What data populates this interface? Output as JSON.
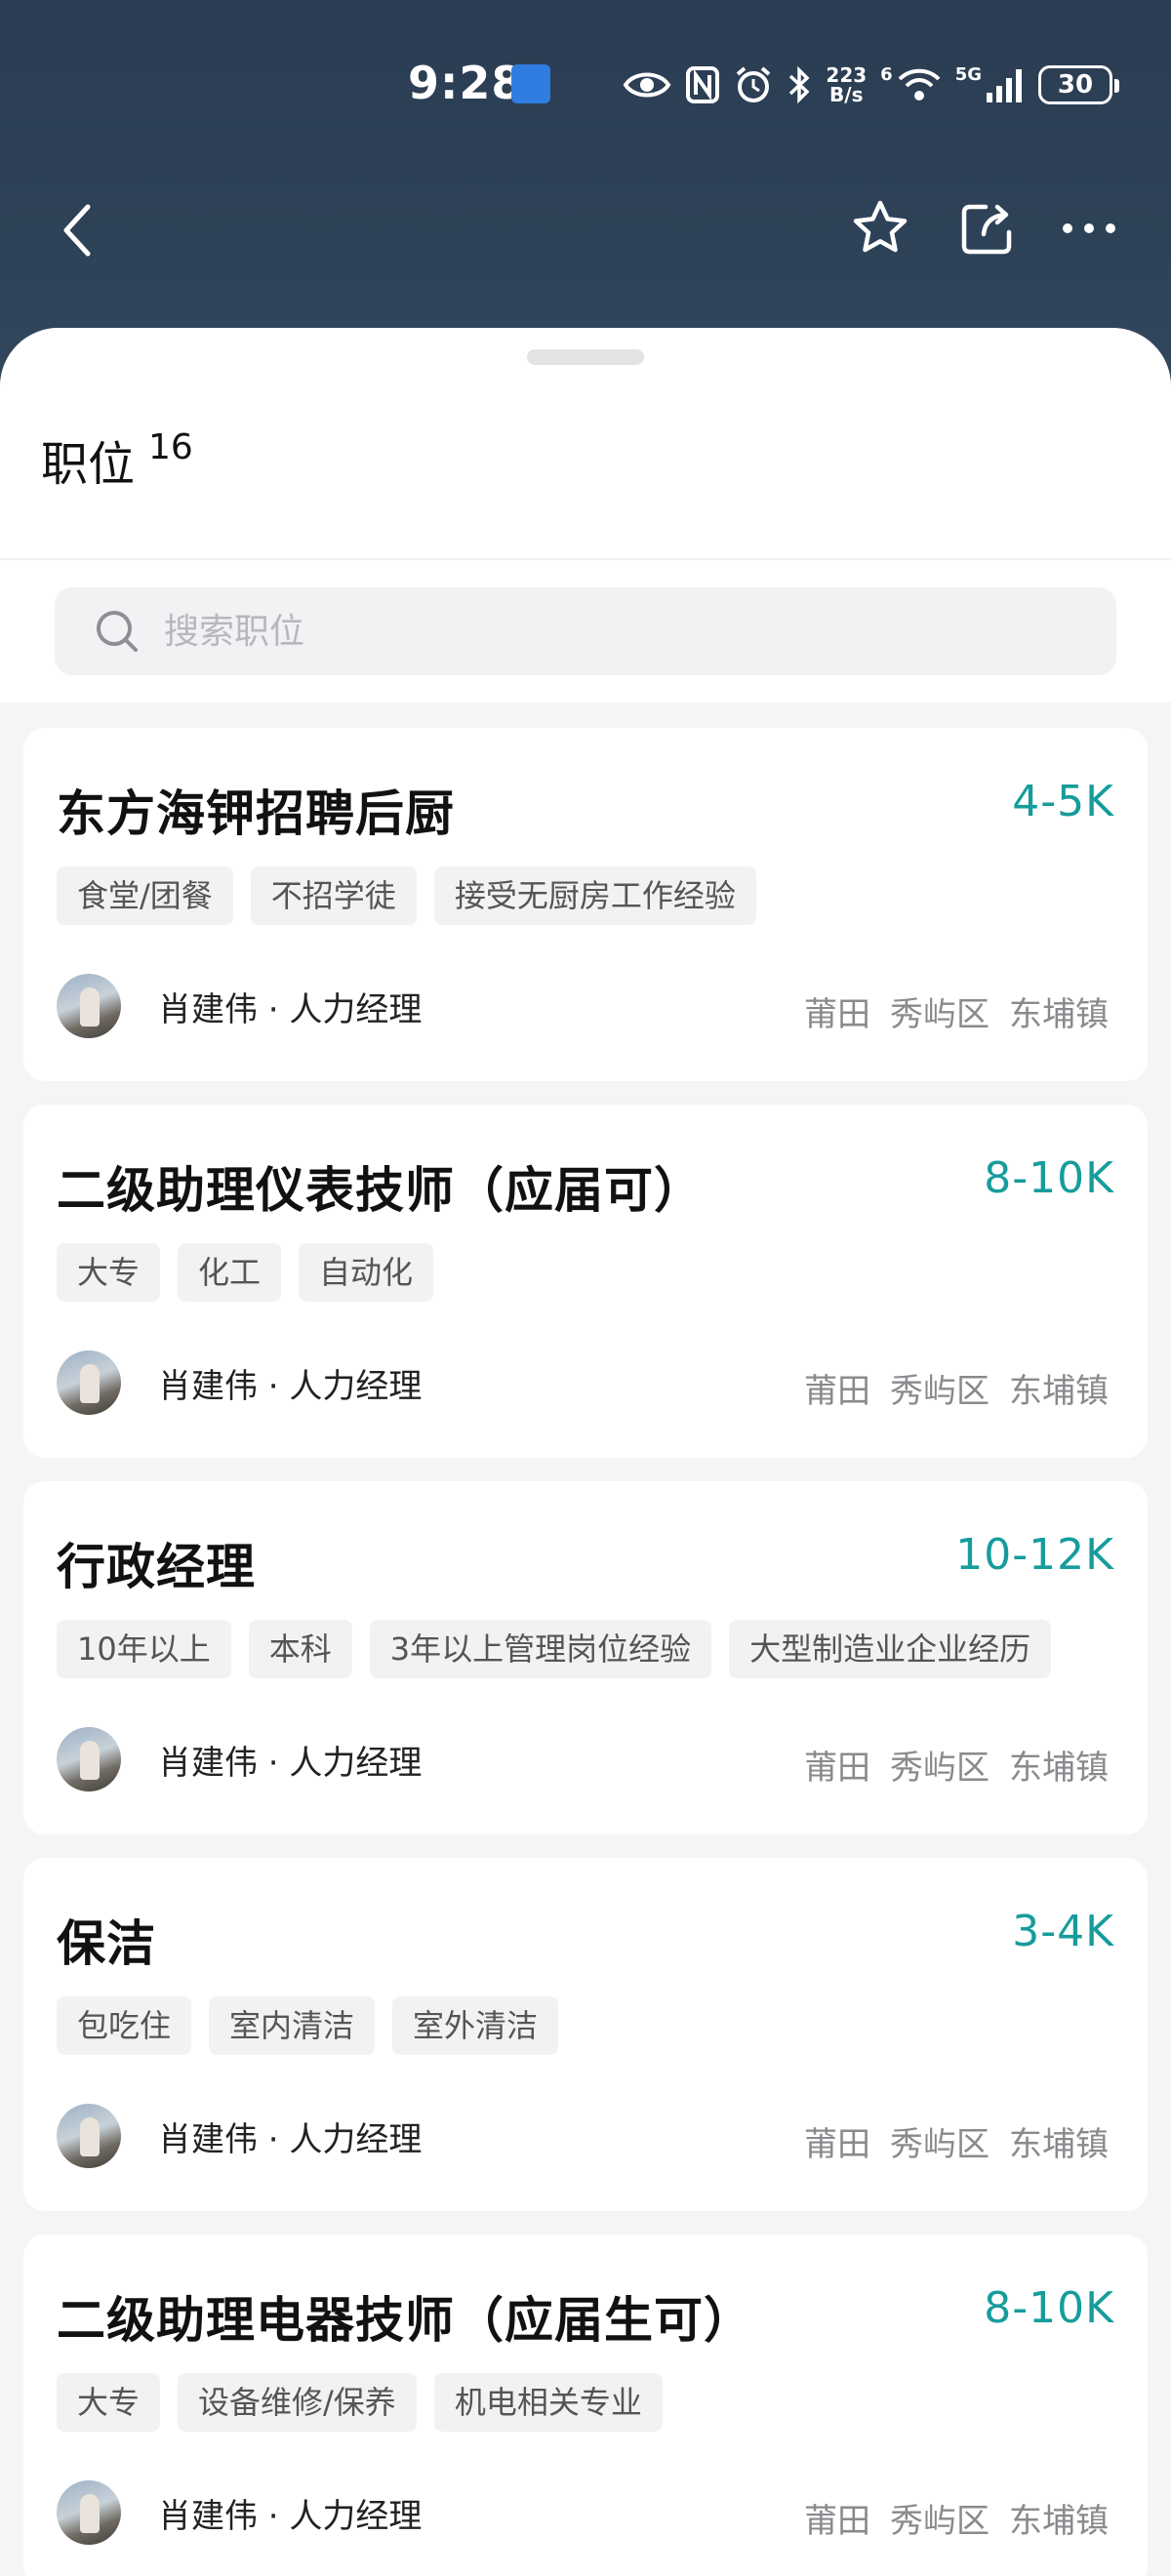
{
  "status_bar": {
    "time": "9:28",
    "net_speed_top": "223",
    "net_speed_bottom": "B/s",
    "signal_label": "5G",
    "wifi_label": "6",
    "battery": "30"
  },
  "toolbar": {
    "back_icon": "chevron-left-icon",
    "favorite_icon": "star-icon",
    "share_icon": "share-icon",
    "more_icon": "more-icon"
  },
  "header": {
    "title": "职位",
    "count": "16"
  },
  "search": {
    "placeholder": "搜索职位"
  },
  "jobs": [
    {
      "title": "东方海钾招聘后厨",
      "salary": "4-5K",
      "tags": [
        "食堂/团餐",
        "不招学徒",
        "接受无厨房工作经验"
      ],
      "recruiter": "肖建伟 · 人力经理",
      "location": [
        "莆田",
        "秀屿区",
        "东埔镇"
      ]
    },
    {
      "title": "二级助理仪表技师（应届可）",
      "salary": "8-10K",
      "tags": [
        "大专",
        "化工",
        "自动化"
      ],
      "recruiter": "肖建伟 · 人力经理",
      "location": [
        "莆田",
        "秀屿区",
        "东埔镇"
      ]
    },
    {
      "title": "行政经理",
      "salary": "10-12K",
      "tags": [
        "10年以上",
        "本科",
        "3年以上管理岗位经验",
        "大型制造业企业经历"
      ],
      "recruiter": "肖建伟 · 人力经理",
      "location": [
        "莆田",
        "秀屿区",
        "东埔镇"
      ]
    },
    {
      "title": "保洁",
      "salary": "3-4K",
      "tags": [
        "包吃住",
        "室内清洁",
        "室外清洁"
      ],
      "recruiter": "肖建伟 · 人力经理",
      "location": [
        "莆田",
        "秀屿区",
        "东埔镇"
      ]
    },
    {
      "title": "二级助理电器技师（应届生可）",
      "salary": "8-10K",
      "tags": [
        "大专",
        "设备维修/保养",
        "机电相关专业"
      ],
      "recruiter": "肖建伟 · 人力经理",
      "location": [
        "莆田",
        "秀屿区",
        "东埔镇"
      ]
    }
  ],
  "colors": {
    "header_bg": "#2b3d53",
    "salary": "#169c9c",
    "tag_bg": "#f2f2f4"
  }
}
